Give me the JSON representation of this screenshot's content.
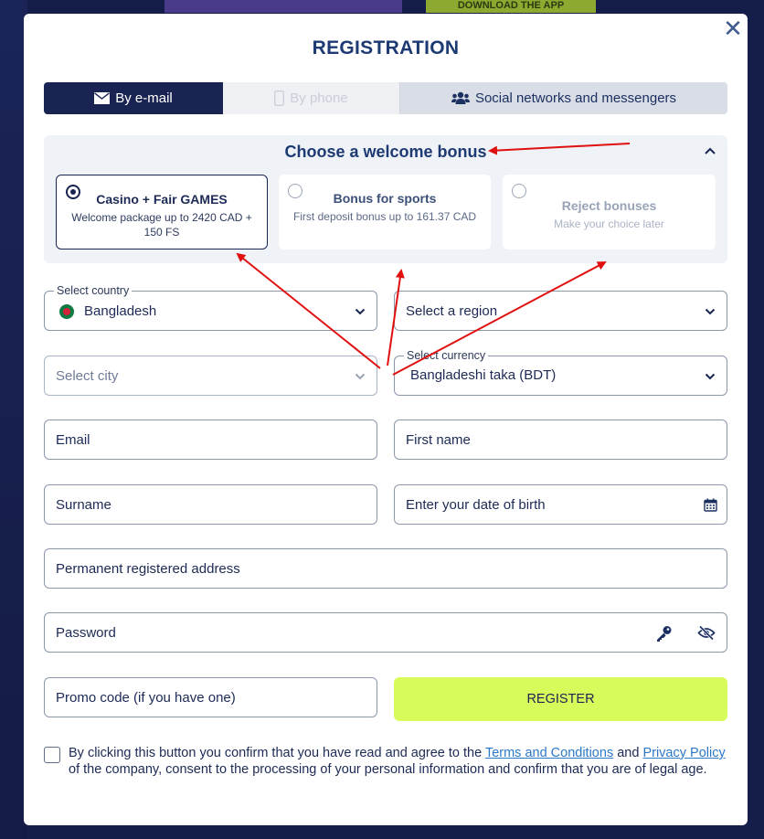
{
  "background": {
    "download_banner": "DOWNLOAD THE APP"
  },
  "modal": {
    "title": "REGISTRATION",
    "close_label": "✕"
  },
  "tabs": [
    {
      "label": "By e-mail",
      "icon": "envelope-icon",
      "state": "active"
    },
    {
      "label": "By phone",
      "icon": "phone-icon",
      "state": "disabled"
    },
    {
      "label": "Social networks and messengers",
      "icon": "users-icon",
      "state": "inactive"
    }
  ],
  "bonus": {
    "title": "Choose a welcome bonus",
    "options": [
      {
        "title": "Casino + Fair GAMES",
        "desc": "Welcome package up to 2420 CAD + 150 FS",
        "selected": true
      },
      {
        "title": "Bonus for sports",
        "desc": "First deposit bonus up to 161.37 CAD",
        "selected": false
      },
      {
        "title": "Reject bonuses",
        "desc": "Make your choice later",
        "selected": false
      }
    ]
  },
  "form": {
    "country": {
      "label": "Select country",
      "value": "Bangladesh"
    },
    "region": {
      "placeholder": "Select a region"
    },
    "city": {
      "placeholder": "Select city"
    },
    "currency": {
      "label": "Select currency",
      "value": "Bangladeshi taka (BDT)"
    },
    "email": {
      "placeholder": "Email"
    },
    "first_name": {
      "placeholder": "First name"
    },
    "surname": {
      "placeholder": "Surname"
    },
    "birth_date": {
      "placeholder": "Enter your date of birth"
    },
    "address": {
      "placeholder": "Permanent registered address"
    },
    "password": {
      "placeholder": "Password"
    },
    "promo": {
      "placeholder": "Promo code (if you have one)"
    },
    "register_label": "REGISTER"
  },
  "agreement": {
    "text_before": "By clicking this button you confirm that you have read and agree to the ",
    "terms_link": "Terms and Conditions",
    "text_and": " and ",
    "privacy_link": "Privacy Policy",
    "text_after": " of the company, consent to the processing of your personal information and confirm that you are of legal age."
  },
  "colors": {
    "primary": "#1a2452",
    "title": "#1d3a72",
    "register_button": "#d8fb5c",
    "link": "#2a78c8",
    "annotation_arrow": "#e01010"
  }
}
